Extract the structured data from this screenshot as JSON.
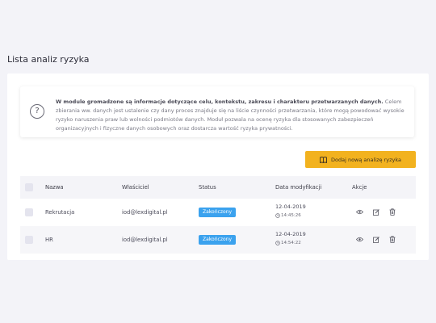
{
  "page": {
    "title": "Lista analiz ryzyka"
  },
  "info": {
    "bold": "W module gromadzone są informacje dotyczące celu, kontekstu, zakresu i charakteru przetwarzanych danych.",
    "text": " Celem zbierania ww. danych jest ustalenie czy dany proces znajduje się na liście czynności przetwarzania, które mogą powodować wysokie ryzyko naruszenia praw lub wolności podmiotów danych. Moduł pozwala na ocenę ryzyka dla stosowanych zabezpieczeń organizacyjnych i fizyczne danych osobowych oraz dostarcza wartość ryzyka prywatności."
  },
  "toolbar": {
    "add_label": "Dodaj nową analizę ryzyka"
  },
  "table": {
    "headers": {
      "name": "Nazwa",
      "owner": "Właściciel",
      "status": "Status",
      "date": "Data modyfikacji",
      "actions": "Akcje"
    },
    "rows": [
      {
        "name": "Rekrutacja",
        "owner": "iod@lexdigital.pl",
        "status": "Zakończony",
        "date": "12-04-2019",
        "time": "14:45:26"
      },
      {
        "name": "HR",
        "owner": "iod@lexdigital.pl",
        "status": "Zakończony",
        "date": "12-04-2019",
        "time": "14:54:22"
      }
    ]
  },
  "colors": {
    "accent": "#f2b21f",
    "badge": "#3ba2ee",
    "background": "#f3f3f8"
  },
  "icons": {
    "info": "question-circle-icon",
    "add": "book-icon",
    "view": "eye-icon",
    "edit": "edit-icon",
    "delete": "trash-icon",
    "time": "clock-icon"
  }
}
